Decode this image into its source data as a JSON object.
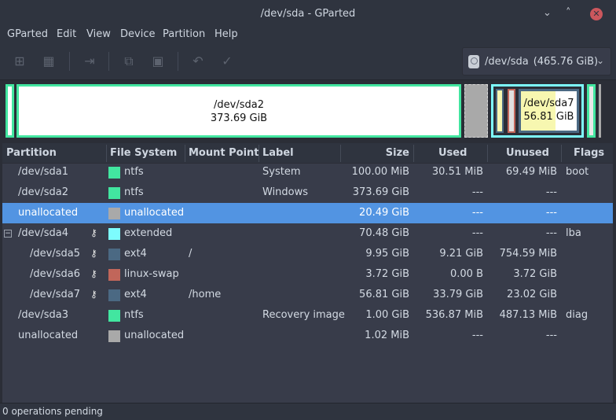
{
  "window": {
    "title": "/dev/sda - GParted",
    "minimize": "⌄",
    "maximize": "˄",
    "close": "✕"
  },
  "menu": [
    "GParted",
    "Edit",
    "View",
    "Device",
    "Partition",
    "Help"
  ],
  "toolbar": {
    "icons": [
      "new-icon",
      "delete-icon",
      "resize-move-icon",
      "copy-icon",
      "paste-icon",
      "undo-icon",
      "apply-icon"
    ],
    "glyphs": [
      "⊞",
      "▦",
      "⇥",
      "⧉",
      "▣",
      "↶",
      "✓"
    ]
  },
  "device": {
    "name": "/dev/sda",
    "size": "(465.76 GiB)",
    "caret": "⌄"
  },
  "diskmap": {
    "sda2_name": "/dev/sda2",
    "sda2_size": "373.69 GiB",
    "sda7_name": "/dev/sda7",
    "sda7_size": "56.81 GiB"
  },
  "colors": {
    "ntfs": "#42e6a0",
    "unallocated": "#a9a9a9",
    "extended": "#7dfcfe",
    "ext4": "#4b6983",
    "linux_swap": "#c1665a",
    "selection": "#5294e2"
  },
  "table": {
    "headers": [
      "Partition",
      "File System",
      "Mount Point",
      "Label",
      "Size",
      "Used",
      "Unused",
      "Flags"
    ],
    "rows": [
      {
        "partition": "/dev/sda1",
        "fs": "ntfs",
        "mount": "",
        "label": "System",
        "size": "100.00 MiB",
        "used": "30.51 MiB",
        "unused": "69.49 MiB",
        "flags": "boot"
      },
      {
        "partition": "/dev/sda2",
        "fs": "ntfs",
        "mount": "",
        "label": "Windows",
        "size": "373.69 GiB",
        "used": "---",
        "unused": "---",
        "flags": ""
      },
      {
        "partition": "unallocated",
        "fs": "unallocated",
        "mount": "",
        "label": "",
        "size": "20.49 GiB",
        "used": "---",
        "unused": "---",
        "flags": ""
      },
      {
        "partition": "/dev/sda4",
        "fs": "extended",
        "mount": "",
        "label": "",
        "size": "70.48 GiB",
        "used": "---",
        "unused": "---",
        "flags": "lba",
        "expander": "−"
      },
      {
        "partition": "/dev/sda5",
        "fs": "ext4",
        "mount": "/",
        "label": "",
        "size": "9.95 GiB",
        "used": "9.21 GiB",
        "unused": "754.59 MiB",
        "flags": ""
      },
      {
        "partition": "/dev/sda6",
        "fs": "linux-swap",
        "mount": "",
        "label": "",
        "size": "3.72 GiB",
        "used": "0.00 B",
        "unused": "3.72 GiB",
        "flags": ""
      },
      {
        "partition": "/dev/sda7",
        "fs": "ext4",
        "mount": "/home",
        "label": "",
        "size": "56.81 GiB",
        "used": "33.79 GiB",
        "unused": "23.02 GiB",
        "flags": ""
      },
      {
        "partition": "/dev/sda3",
        "fs": "ntfs",
        "mount": "",
        "label": "Recovery image",
        "size": "1.00 GiB",
        "used": "536.87 MiB",
        "unused": "487.13 MiB",
        "flags": "diag"
      },
      {
        "partition": "unallocated",
        "fs": "unallocated",
        "mount": "",
        "label": "",
        "size": "1.02 MiB",
        "used": "---",
        "unused": "---",
        "flags": ""
      }
    ]
  },
  "status": "0 operations pending",
  "key_glyph": "⚷"
}
